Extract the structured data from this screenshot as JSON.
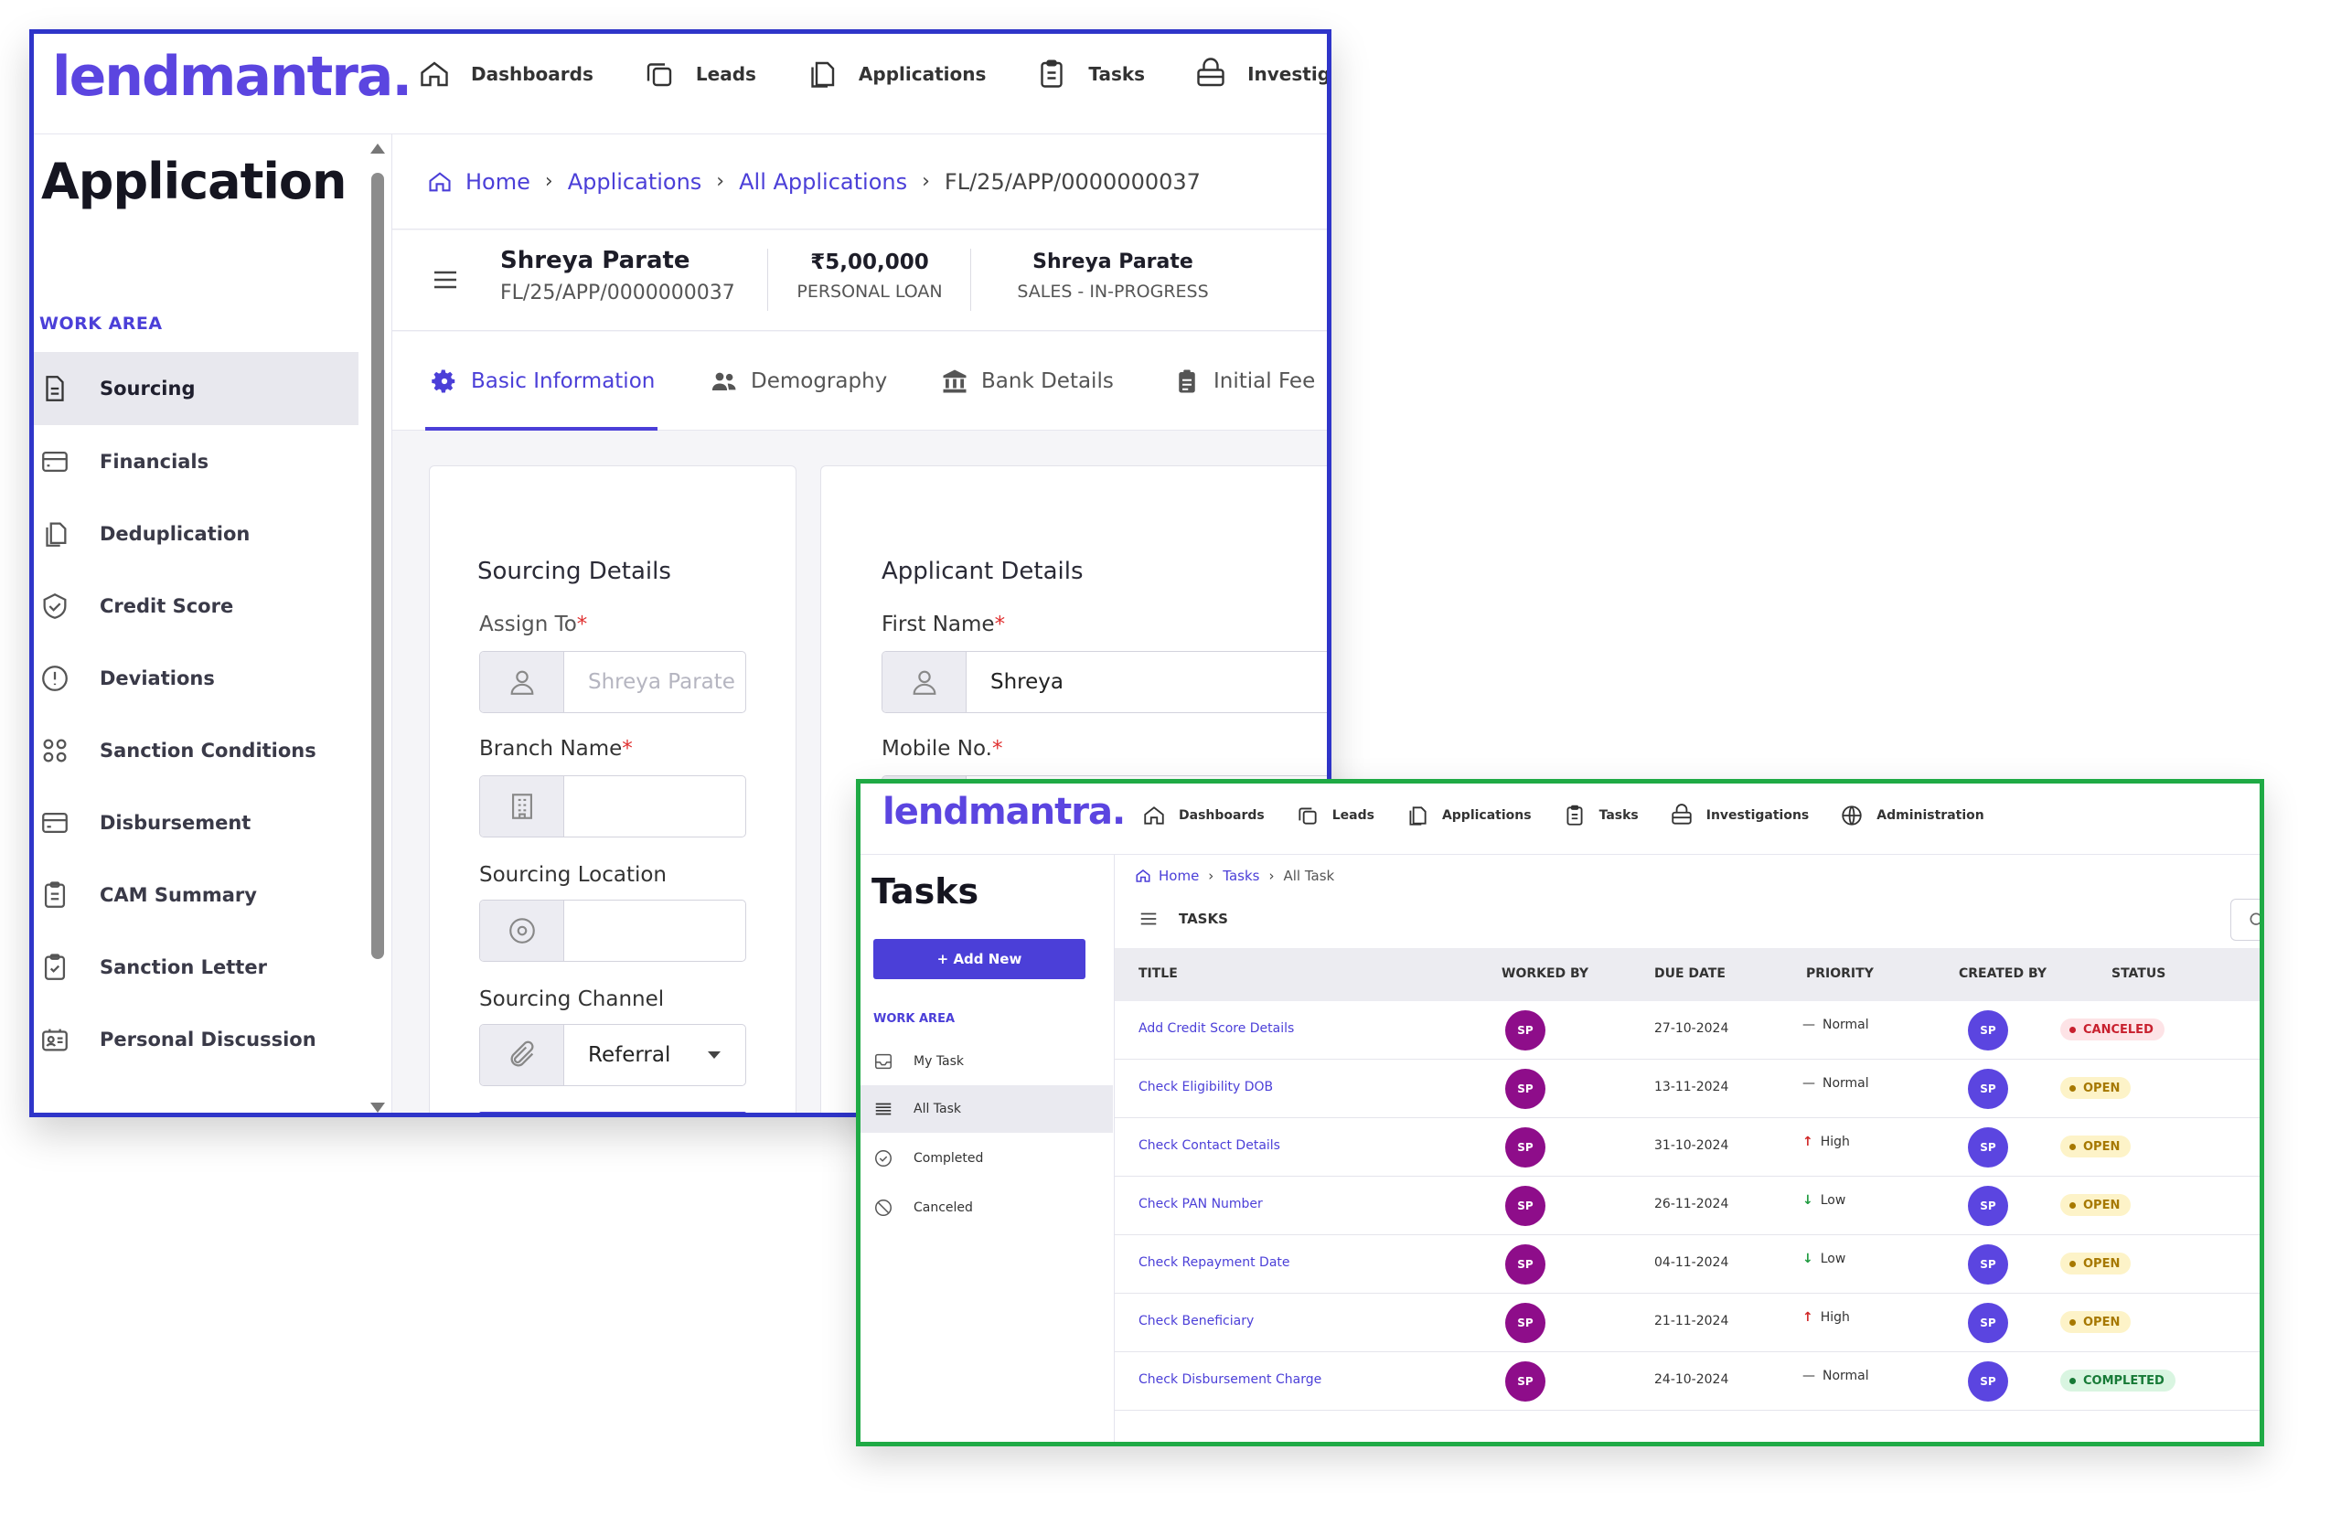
{
  "app1": {
    "logo": "lendmantra.",
    "nav": [
      {
        "label": "Dashboards",
        "icon": "home-icon"
      },
      {
        "label": "Leads",
        "icon": "copy-icon"
      },
      {
        "label": "Applications",
        "icon": "document-icon"
      },
      {
        "label": "Tasks",
        "icon": "clipboard-icon"
      },
      {
        "label": "Investigati",
        "icon": "briefcase-icon"
      }
    ],
    "page_title": "Application",
    "work_area": "WORK AREA",
    "sidebar": [
      {
        "label": "Sourcing",
        "icon": "document-icon",
        "active": true
      },
      {
        "label": "Financials",
        "icon": "card-icon"
      },
      {
        "label": "Deduplication",
        "icon": "copy-icon"
      },
      {
        "label": "Credit Score",
        "icon": "shield-icon"
      },
      {
        "label": "Deviations",
        "icon": "alert-icon"
      },
      {
        "label": "Sanction Conditions",
        "icon": "grid-icon"
      },
      {
        "label": "Disbursement",
        "icon": "card-icon"
      },
      {
        "label": "CAM Summary",
        "icon": "clipboard-icon"
      },
      {
        "label": "Sanction Letter",
        "icon": "clipboard-check-icon"
      },
      {
        "label": "Personal Discussion",
        "icon": "contact-icon"
      }
    ],
    "breadcrumb": {
      "home": "Home",
      "applications": "Applications",
      "all_applications": "All Applications",
      "current": "FL/25/APP/0000000037"
    },
    "header": {
      "name": "Shreya Parate",
      "app_id": "FL/25/APP/0000000037",
      "amount": "₹5,00,000",
      "loan_type": "PERSONAL LOAN",
      "owner": "Shreya Parate",
      "stage": "SALES - IN-PROGRESS"
    },
    "tabs": [
      {
        "label": "Basic Information",
        "icon": "gear-icon",
        "active": true
      },
      {
        "label": "Demography",
        "icon": "users-icon"
      },
      {
        "label": "Bank Details",
        "icon": "bank-icon"
      },
      {
        "label": "Initial Fee",
        "icon": "receipt-icon"
      }
    ],
    "sourcing": {
      "title": "Sourcing Details",
      "assign_to_label": "Assign To",
      "assign_to_value": "Shreya Parate",
      "branch_label": "Branch Name",
      "branch_value": "",
      "location_label": "Sourcing Location",
      "location_value": "",
      "channel_label": "Sourcing Channel",
      "channel_value": "Referral",
      "required_mark": "*"
    },
    "applicant": {
      "title": "Applicant Details",
      "first_name_label": "First Name",
      "first_name_value": "Shreya",
      "mobile_label": "Mobile No."
    }
  },
  "app2": {
    "logo": "lendmantra.",
    "nav": [
      {
        "label": "Dashboards",
        "icon": "home-icon"
      },
      {
        "label": "Leads",
        "icon": "copy-icon"
      },
      {
        "label": "Applications",
        "icon": "document-icon"
      },
      {
        "label": "Tasks",
        "icon": "clipboard-icon"
      },
      {
        "label": "Investigations",
        "icon": "briefcase-icon"
      },
      {
        "label": "Administration",
        "icon": "globe-icon"
      }
    ],
    "page_title": "Tasks",
    "add_new": "+ Add New",
    "work_area": "WORK AREA",
    "sidebar": [
      {
        "label": "My Task",
        "icon": "inbox-icon"
      },
      {
        "label": "All Task",
        "icon": "list-icon",
        "active": true
      },
      {
        "label": "Completed",
        "icon": "check-circle-icon"
      },
      {
        "label": "Canceled",
        "icon": "ban-icon"
      }
    ],
    "breadcrumb": {
      "home": "Home",
      "tasks": "Tasks",
      "current": "All Task"
    },
    "tasks_heading": "TASKS",
    "columns": [
      "TITLE",
      "WORKED BY",
      "DUE DATE",
      "PRIORITY",
      "CREATED BY",
      "STATUS"
    ],
    "rows": [
      {
        "title": "Add Credit Score Details",
        "worked_by": "SP",
        "due": "27-10-2024",
        "priority": "Normal",
        "priority_icon": "dash-icon",
        "created_by": "SP",
        "status": "CANCELED",
        "status_type": "c"
      },
      {
        "title": "Check Eligibility DOB",
        "worked_by": "SP",
        "due": "13-11-2024",
        "priority": "Normal",
        "priority_icon": "dash-icon",
        "created_by": "SP",
        "status": "OPEN",
        "status_type": "o"
      },
      {
        "title": "Check Contact Details",
        "worked_by": "SP",
        "due": "31-10-2024",
        "priority": "High",
        "priority_icon": "arrow-up-icon",
        "created_by": "SP",
        "status": "OPEN",
        "status_type": "o"
      },
      {
        "title": "Check PAN Number",
        "worked_by": "SP",
        "due": "26-11-2024",
        "priority": "Low",
        "priority_icon": "arrow-down-icon",
        "created_by": "SP",
        "status": "OPEN",
        "status_type": "o"
      },
      {
        "title": "Check Repayment Date",
        "worked_by": "SP",
        "due": "04-11-2024",
        "priority": "Low",
        "priority_icon": "arrow-down-icon",
        "created_by": "SP",
        "status": "OPEN",
        "status_type": "o"
      },
      {
        "title": "Check Beneficiary",
        "worked_by": "SP",
        "due": "21-11-2024",
        "priority": "High",
        "priority_icon": "arrow-up-icon",
        "created_by": "SP",
        "status": "OPEN",
        "status_type": "o"
      },
      {
        "title": "Check Disbursement Charge",
        "worked_by": "SP",
        "due": "24-10-2024",
        "priority": "Normal",
        "priority_icon": "dash-icon",
        "created_by": "SP",
        "status": "COMPLETED",
        "status_type": "d"
      }
    ]
  },
  "colors": {
    "brand": "#5b45e0",
    "frame1": "#2f35c9",
    "frame2": "#1faa45",
    "worked_avatar": "#8e0d8a"
  }
}
